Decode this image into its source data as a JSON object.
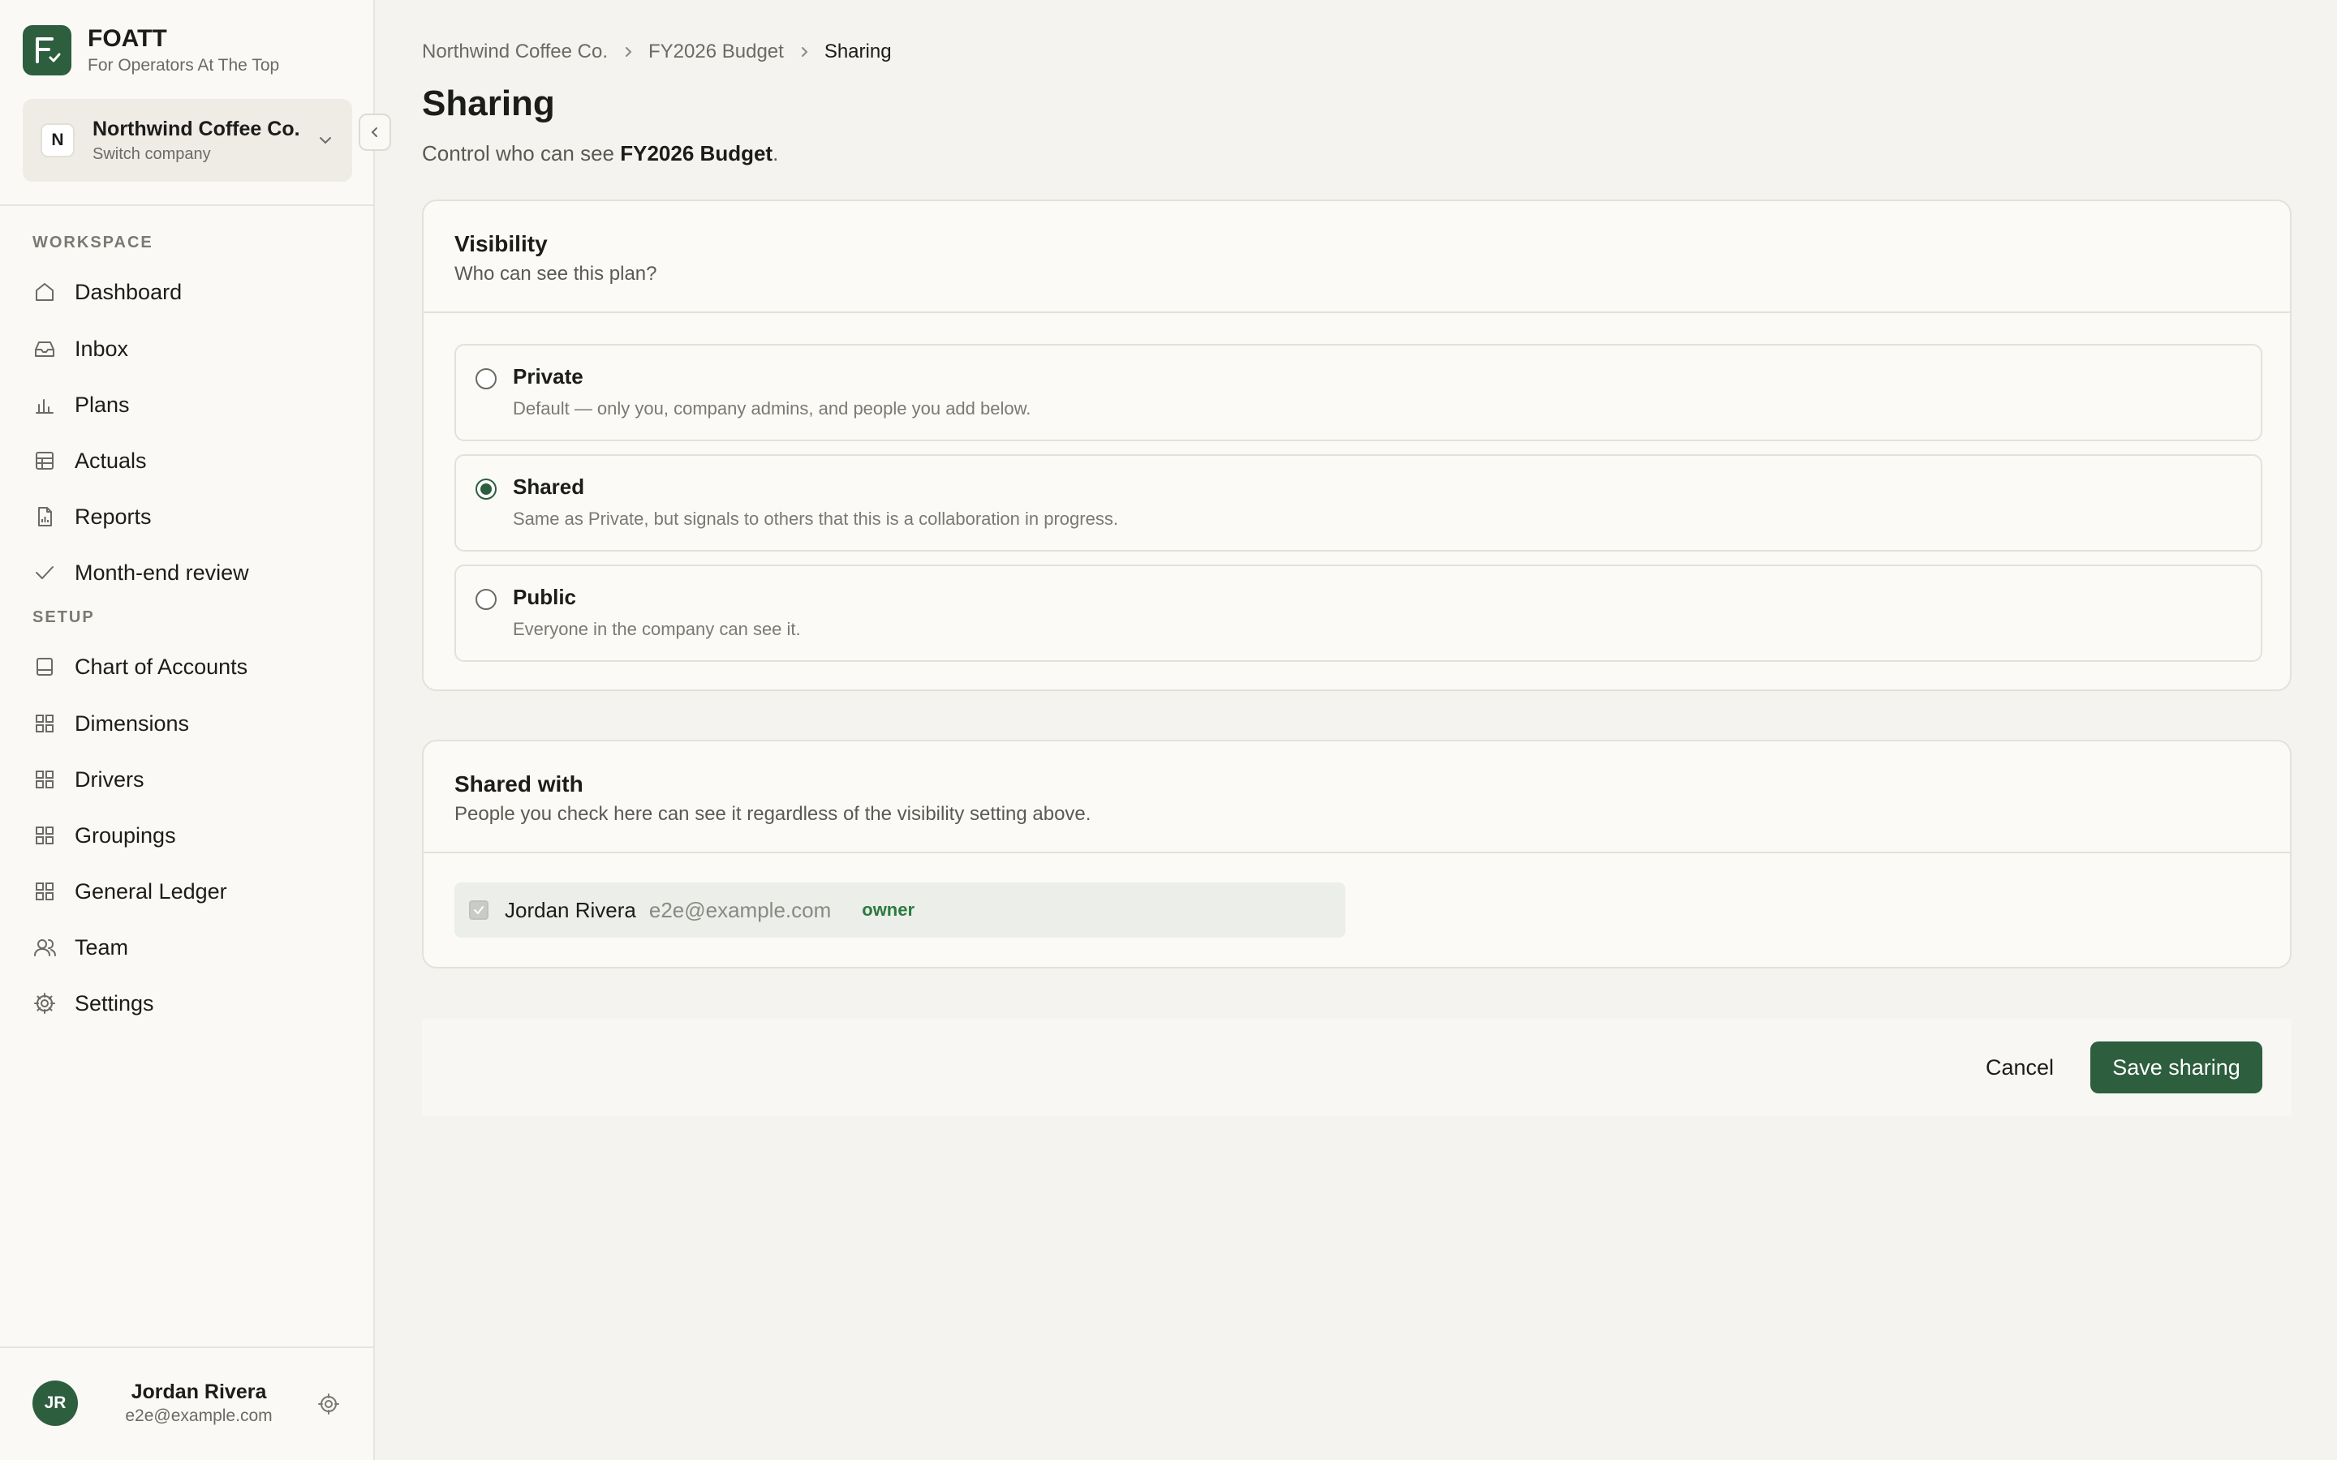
{
  "brand": {
    "name": "FOATT",
    "tagline": "For Operators At The Top",
    "logo_letter": "F"
  },
  "company": {
    "initial": "N",
    "name": "Northwind Coffee Co.",
    "subtitle": "Switch company"
  },
  "nav": {
    "workspace_label": "WORKSPACE",
    "workspace_items": [
      {
        "label": "Dashboard",
        "icon": "home-icon"
      },
      {
        "label": "Inbox",
        "icon": "inbox-icon"
      },
      {
        "label": "Plans",
        "icon": "bar-chart-icon"
      },
      {
        "label": "Actuals",
        "icon": "table-icon"
      },
      {
        "label": "Reports",
        "icon": "report-icon"
      },
      {
        "label": "Month-end review",
        "icon": "check-icon"
      }
    ],
    "setup_label": "SETUP",
    "setup_items": [
      {
        "label": "Chart of Accounts",
        "icon": "book-icon"
      },
      {
        "label": "Dimensions",
        "icon": "grid-icon"
      },
      {
        "label": "Drivers",
        "icon": "grid-icon"
      },
      {
        "label": "Groupings",
        "icon": "grid-icon"
      },
      {
        "label": "General Ledger",
        "icon": "grid-icon"
      },
      {
        "label": "Team",
        "icon": "users-icon"
      },
      {
        "label": "Settings",
        "icon": "gear-icon"
      }
    ]
  },
  "user": {
    "initials": "JR",
    "name": "Jordan Rivera",
    "email": "e2e@example.com"
  },
  "breadcrumb": [
    "Northwind Coffee Co.",
    "FY2026 Budget",
    "Sharing"
  ],
  "page": {
    "title": "Sharing",
    "desc_prefix": "Control who can see ",
    "desc_plan": "FY2026 Budget",
    "desc_suffix": "."
  },
  "visibility": {
    "title": "Visibility",
    "subtitle": "Who can see this plan?",
    "selected": "Shared",
    "options": [
      {
        "label": "Private",
        "desc": "Default — only you, company admins, and people you add below."
      },
      {
        "label": "Shared",
        "desc": "Same as Private, but signals to others that this is a collaboration in progress."
      },
      {
        "label": "Public",
        "desc": "Everyone in the company can see it."
      }
    ]
  },
  "shared_with": {
    "title": "Shared with",
    "subtitle": "People you check here can see it regardless of the visibility setting above.",
    "members": [
      {
        "name": "Jordan Rivera",
        "email": "e2e@example.com",
        "role": "owner",
        "checked": true
      }
    ]
  },
  "actions": {
    "cancel": "Cancel",
    "save": "Save sharing"
  },
  "colors": {
    "accent": "#2d5e3e",
    "role_green": "#2d7a3e",
    "background": "#f4f3ef"
  }
}
